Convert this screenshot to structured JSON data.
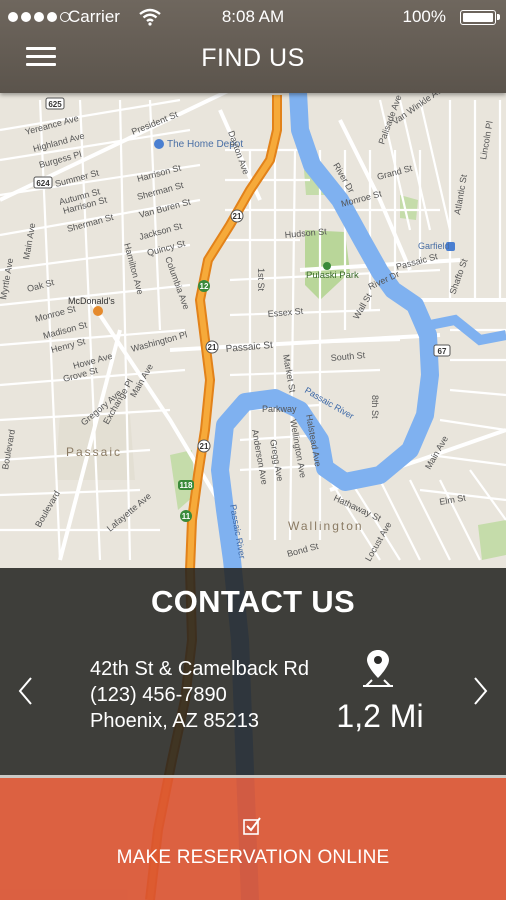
{
  "status_bar": {
    "carrier": "Carrier",
    "time": "8:08 AM",
    "battery": "100%"
  },
  "header": {
    "title": "FIND US"
  },
  "map": {
    "labels": {
      "president_st": "President St",
      "the_home_depot": "The Home Depot",
      "dayton_ave": "Dayton Ave",
      "highland_ave": "Highland Ave",
      "yereance_ave": "Yereance Ave",
      "burgess_pl": "Burgess Pl",
      "summer_st": "Summer St",
      "autumn_st": "Autumn St",
      "sherman_st": "Sherman St",
      "harrison_st": "Harrison St",
      "van_buren_st": "Van Buren St",
      "jackson_st": "Jackson St",
      "quincy_st": "Quincy St",
      "columbia_ave": "Columbia Ave",
      "hamilton_ave": "Hamilton Ave",
      "myrtle_ave": "Myrtle Ave",
      "mcdonalds": "McDonald's",
      "oak_st": "Oak St",
      "monroe_st": "Monroe St",
      "madison_st": "Madison St",
      "henry_st": "Henry St",
      "howe_ave": "Howe Ave",
      "grove_st": "Grove St",
      "washington_pl": "Washington Pl",
      "main_ave": "Main Ave",
      "exchange_pl": "Exchange Pl",
      "gregory_ave": "Gregory Ave",
      "passaic_city": "Passaic",
      "boulevard": "Boulevard",
      "lafayette_ave": "Lafayette Ave",
      "river_dr": "River Dr",
      "monroe_st_east": "Monroe St",
      "grand_st": "Grand St",
      "hudson_st": "Hudson St",
      "pulaski_park": "Pulaski Park",
      "passaic_st": "Passaic St",
      "garfield": "Garfield",
      "passaic_river": "Passaic River",
      "wallington": "Wallington",
      "wall_st": "Wall St",
      "south_st": "South St",
      "main_ave_east": "Main Ave",
      "locust_ave": "Locust Ave",
      "hathaway_st": "Hathaway St",
      "bond_st": "Bond St",
      "parkway": "Parkway",
      "essex_st": "Essex St",
      "1st_st": "1st St",
      "8th_st": "8th St",
      "van_winkle_ave": "Van Winkle Ave",
      "palisade_ave": "Palisade Ave",
      "lincoln_pl": "Lincoln Pl",
      "atlantic_st": "Atlantic St",
      "shafto_st": "Shafto St",
      "gregg_ave": "Gregg Ave",
      "halstead_ave": "Halstead Ave",
      "wellington_ave": "Wellington Ave",
      "anderson_ave": "Anderson Ave",
      "market_st": "Market St",
      "river_dr_south": "River Dr",
      "elm_st": "Elm St"
    },
    "shields": [
      "625",
      "624",
      "21",
      "12",
      "21",
      "21",
      "118",
      "11",
      "67"
    ]
  },
  "contact": {
    "title": "CONTACT US",
    "address_line1": "42th St & Camelback Rd",
    "phone": "(123) 456-7890",
    "city": "Phoenix, AZ 85213",
    "distance": "1,2 Mi"
  },
  "reservation": {
    "label": "MAKE RESERVATION ONLINE"
  },
  "colors": {
    "header_bg": "#5f5850",
    "panel_bg": "#222220",
    "accent_orange": "#da5230",
    "route": "#f39a22",
    "river": "#7fb1f0",
    "park": "#b9d699"
  }
}
